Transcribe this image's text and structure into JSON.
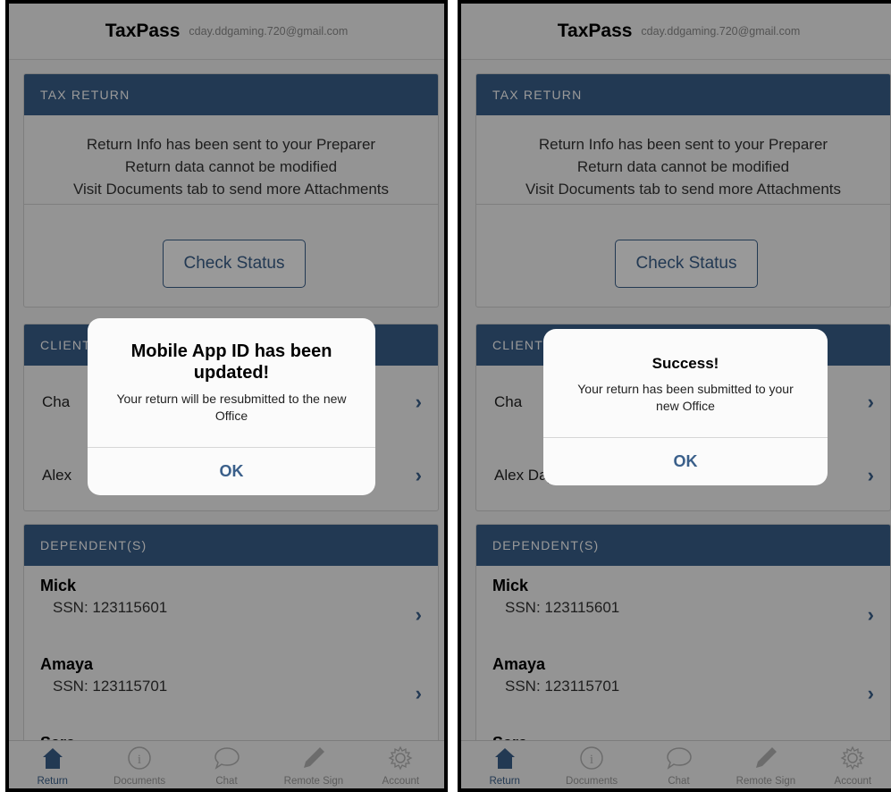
{
  "app": {
    "title": "TaxPass",
    "email": "cday.ddgaming.720@gmail.com"
  },
  "tax_return": {
    "header": "TAX RETURN",
    "lines": [
      "Return Info has been sent to your Preparer",
      "Return data cannot be modified",
      "Visit Documents tab to send more Attachments"
    ],
    "check_status_label": "Check Status"
  },
  "clients": {
    "header": "CLIENT",
    "rows": [
      "Cha",
      "Alex"
    ],
    "rows_right": [
      "Cha",
      "Alex Day"
    ]
  },
  "dependents": {
    "header": "DEPENDENT(S)",
    "items": [
      {
        "name": "Mick",
        "ssn": "SSN: 123115601"
      },
      {
        "name": "Amaya",
        "ssn": "SSN: 123115701"
      },
      {
        "name": "Sara",
        "ssn": ""
      }
    ]
  },
  "tabs": [
    {
      "label": "Return",
      "icon": "home-icon",
      "active": true
    },
    {
      "label": "Documents",
      "icon": "info-icon",
      "active": false
    },
    {
      "label": "Chat",
      "icon": "chat-bubble-icon",
      "active": false
    },
    {
      "label": "Remote Sign",
      "icon": "pencil-icon",
      "active": false
    },
    {
      "label": "Account",
      "icon": "gear-icon",
      "active": false
    }
  ],
  "dialog_left": {
    "title": "Mobile App ID has been updated!",
    "message": "Your return will be resubmitted to the new Office",
    "ok_label": "OK"
  },
  "dialog_right": {
    "title": "Success!",
    "message": "Your return has been submitted to your new Office",
    "ok_label": "OK"
  },
  "colors": {
    "accent": "#3a5f8a",
    "header_bg": "#3a5f8a",
    "overlay": "rgba(0,0,0,0.40)"
  }
}
